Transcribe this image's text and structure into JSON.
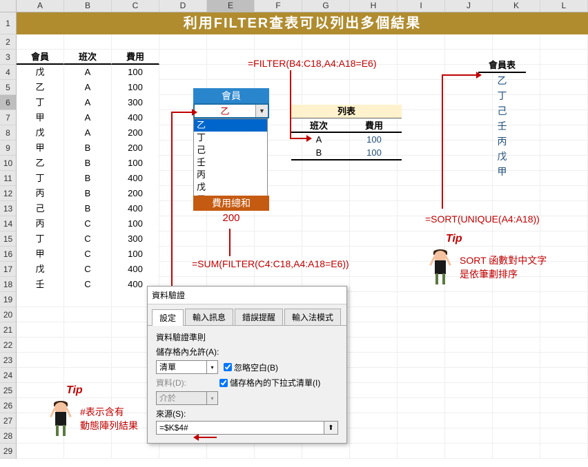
{
  "colheads": [
    "A",
    "B",
    "C",
    "D",
    "E",
    "F",
    "G",
    "H",
    "I",
    "J",
    "K",
    "L"
  ],
  "rowcount": 29,
  "banner": "利用FILTER查表可以列出多個結果",
  "table": {
    "headers": [
      "會員",
      "班次",
      "費用"
    ],
    "rows": [
      [
        "戊",
        "A",
        "100"
      ],
      [
        "乙",
        "A",
        "100"
      ],
      [
        "丁",
        "A",
        "300"
      ],
      [
        "甲",
        "A",
        "400"
      ],
      [
        "戊",
        "A",
        "200"
      ],
      [
        "甲",
        "B",
        "200"
      ],
      [
        "乙",
        "B",
        "100"
      ],
      [
        "丁",
        "B",
        "400"
      ],
      [
        "丙",
        "B",
        "200"
      ],
      [
        "己",
        "B",
        "400"
      ],
      [
        "丙",
        "C",
        "100"
      ],
      [
        "丁",
        "C",
        "300"
      ],
      [
        "甲",
        "C",
        "100"
      ],
      [
        "戊",
        "C",
        "400"
      ],
      [
        "壬",
        "C",
        "400"
      ]
    ]
  },
  "dropdown": {
    "title": "會員",
    "selected": "乙",
    "items": [
      "乙",
      "丁",
      "己",
      "壬",
      "丙",
      "戊",
      "甲"
    ]
  },
  "sum": {
    "label": "費用總和",
    "value": "200"
  },
  "formulas": {
    "filter": "=FILTER(B4:C18,A4:A18=E6)",
    "sumfilter": "=SUM(FILTER(C4:C18,A4:A18=E6))",
    "sortunique": "=SORT(UNIQUE(A4:A18))"
  },
  "listtbl": {
    "title": "列表",
    "headers": [
      "班次",
      "費用"
    ],
    "rows": [
      [
        "A",
        "100"
      ],
      [
        "B",
        "100"
      ]
    ]
  },
  "memtbl": {
    "title": "會員表",
    "rows": [
      "乙",
      "丁",
      "己",
      "壬",
      "丙",
      "戊",
      "甲"
    ]
  },
  "tip1": {
    "label": "Tip",
    "line1": "#表示含有",
    "line2": "動態陣列結果"
  },
  "tip2": {
    "label": "Tip",
    "line1": "SORT 函數對中文字",
    "line2": "是依筆劃排序"
  },
  "dialog": {
    "title": "資料驗證",
    "tabs": [
      "設定",
      "輸入訊息",
      "錯誤提醒",
      "輸入法模式"
    ],
    "group_title": "資料驗證準則",
    "allow_label": "儲存格內允許(A):",
    "allow_value": "清單",
    "chk1": "忽略空白(B)",
    "chk2": "儲存格內的下拉式清單(I)",
    "data_label": "資料(D):",
    "data_value": "介於",
    "source_label": "來源(S):",
    "source_value": "=$K$4#"
  }
}
